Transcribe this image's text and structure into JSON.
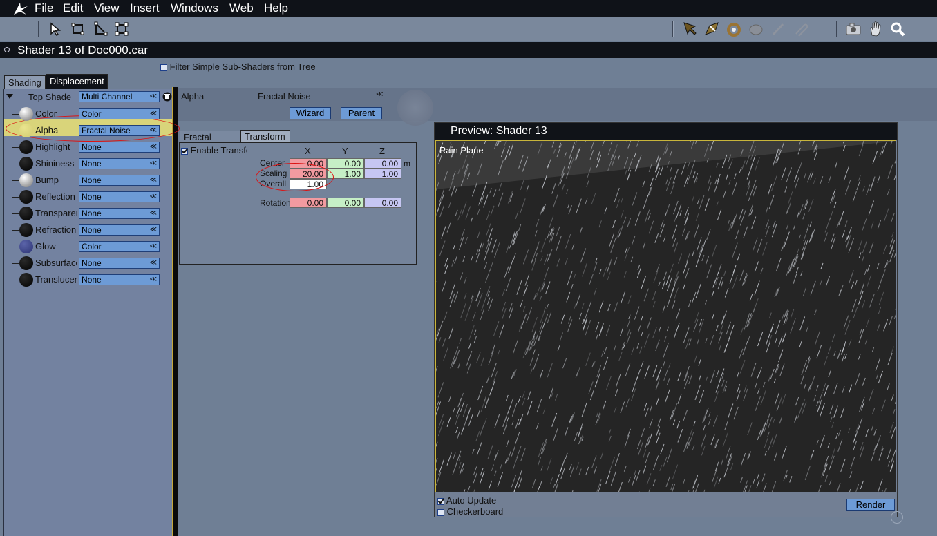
{
  "menu": {
    "items": [
      "File",
      "Edit",
      "View",
      "Insert",
      "Windows",
      "Web",
      "Help"
    ]
  },
  "toolbar": {
    "left_icons": [
      "select-arrow-icon",
      "rectangle-select-icon",
      "polygon-select-icon",
      "transform-icon"
    ],
    "right_icons": [
      "pointer-arrow-icon",
      "camera-angle-icon",
      "rotate-icon",
      "sphere-icon",
      "brush-icon",
      "paperclip-icon",
      "camera-icon",
      "hand-icon",
      "zoom-icon"
    ]
  },
  "window": {
    "title": "Shader 13 of Doc000.car"
  },
  "filter": {
    "label": "Filter Simple Sub-Shaders from Tree",
    "checked": false
  },
  "tabs": {
    "shading": "Shading",
    "displacement": "Displacement"
  },
  "tree": {
    "top": {
      "label": "Top Shade",
      "value": "Multi Channel"
    },
    "rows": [
      {
        "label": "Color",
        "value": "Color",
        "ball": "white"
      },
      {
        "label": "Alpha",
        "value": "Fractal Noise",
        "ball": "yellow"
      },
      {
        "label": "Highlight",
        "value": "None",
        "ball": "black"
      },
      {
        "label": "Shininess",
        "value": "None",
        "ball": "black"
      },
      {
        "label": "Bump",
        "value": "None",
        "ball": "white"
      },
      {
        "label": "Reflection",
        "value": "None",
        "ball": "black"
      },
      {
        "label": "Transparency",
        "value": "None",
        "ball": "black"
      },
      {
        "label": "Refraction",
        "value": "None",
        "ball": "black"
      },
      {
        "label": "Glow",
        "value": "Color",
        "ball": "blue"
      },
      {
        "label": "Subsurface",
        "value": "None",
        "ball": "black"
      },
      {
        "label": "Translucency",
        "value": "None",
        "ball": "black"
      }
    ]
  },
  "channel": {
    "name": "Alpha",
    "shader": "Fractal Noise",
    "wizard": "Wizard",
    "parent": "Parent"
  },
  "subtabs": {
    "fractal": "Fractal Noise",
    "transform": "Transform"
  },
  "transform": {
    "enable_label": "Enable Transform",
    "enabled": true,
    "headers": [
      "X",
      "Y",
      "Z"
    ],
    "center": {
      "label": "Center",
      "x": "0.00",
      "y": "0.00",
      "z": "0.00",
      "unit": "m"
    },
    "scaling": {
      "label": "Scaling",
      "x": "20.00",
      "y": "1.00",
      "z": "1.00"
    },
    "overall": {
      "label": "Overall",
      "value": "1.00"
    },
    "rotation": {
      "label": "Rotation",
      "x": "0.00",
      "y": "0.00",
      "z": "0.00"
    }
  },
  "preview": {
    "title": "Preview: Shader 13",
    "object": "Rain Plane",
    "auto_update": {
      "label": "Auto Update",
      "checked": true
    },
    "checkerboard": {
      "label": "Checkerboard",
      "checked": false
    },
    "render": "Render"
  },
  "colors": {
    "highlight": "#d9d47a",
    "ellipse": "#dd1111"
  }
}
